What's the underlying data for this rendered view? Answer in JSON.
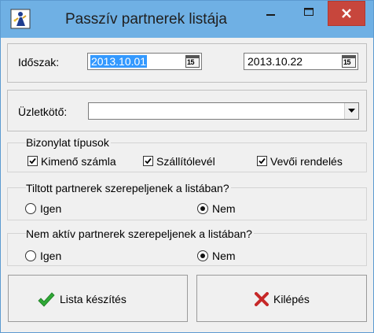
{
  "window": {
    "title": "Passzív partnerek listája",
    "accent_color": "#6fb0e4",
    "close_color": "#c7463c"
  },
  "period": {
    "label": "Időszak:",
    "start_date": "2013.10.01",
    "end_date": "2013.10.22",
    "calendar_button": "15"
  },
  "agent": {
    "label": "Üzletkötő:",
    "value": ""
  },
  "document_types": {
    "title": "Bizonylat típusok",
    "items": [
      {
        "label": "Kimenő számla",
        "checked": true
      },
      {
        "label": "Szállítólevél",
        "checked": true
      },
      {
        "label": "Vevői rendelés",
        "checked": true
      }
    ]
  },
  "banned_partners": {
    "question": "Tiltott partnerek szerepeljenek a listában?",
    "yes": "Igen",
    "no": "Nem",
    "selected": "Nem"
  },
  "inactive_partners": {
    "question": "Nem aktív partnerek szerepeljenek a listában?",
    "yes": "Igen",
    "no": "Nem",
    "selected": "Nem"
  },
  "buttons": {
    "create": "Lista készítés",
    "exit": "Kilépés"
  }
}
